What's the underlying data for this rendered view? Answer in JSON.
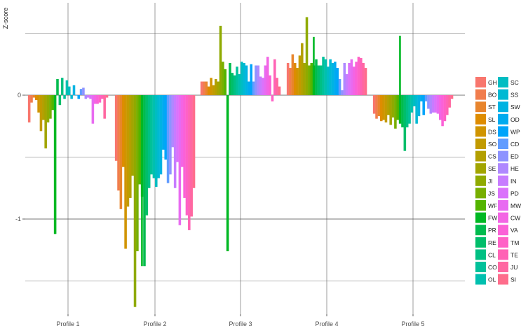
{
  "chart_data": {
    "type": "bar",
    "title": "",
    "xlabel": "",
    "ylabel": "Z-score",
    "categories": [
      "Profile 1",
      "Profile 2",
      "Profile 3",
      "Profile 4",
      "Profile 5"
    ],
    "y_tick_labels": [
      "-1",
      "0"
    ],
    "y_ticks": [
      -1,
      0
    ],
    "ylim": [
      -1.89,
      0.66
    ],
    "grid": true,
    "legend_position": "right",
    "legend_title": "",
    "series_names": [
      "GH",
      "BO",
      "ST",
      "SL",
      "DS",
      "SO",
      "CS",
      "SE",
      "JI",
      "JS",
      "WF",
      "FW",
      "PR",
      "RE",
      "CL",
      "CO",
      "OL",
      "SC",
      "SS",
      "SW",
      "OD",
      "WP",
      "CD",
      "ED",
      "HE",
      "IN",
      "PD",
      "MW",
      "CW",
      "VA",
      "TM",
      "TE",
      "JU",
      "SI"
    ],
    "series_colors": [
      "#F8766D",
      "#F17D4D",
      "#E8852D",
      "#DE8C00",
      "#D09400",
      "#C29A00",
      "#B39F00",
      "#A2A500",
      "#8FAA00",
      "#77AF00",
      "#53B400",
      "#00B823",
      "#00BB4E",
      "#00BE6A",
      "#00C083",
      "#00C19A",
      "#00C0AF",
      "#00BDC2",
      "#00B9D3",
      "#00B3E2",
      "#00ABEF",
      "#00A4FA",
      "#619CFF",
      "#8E93FF",
      "#AF88FF",
      "#C77CFF",
      "#DA72FB",
      "#E86BF1",
      "#F365E4",
      "#FB61D7",
      "#FF61C6",
      "#FF63B5",
      "#FF68A1",
      "#FE6D8C"
    ],
    "values": [
      [
        -0.22,
        -0.06,
        -0.02,
        -0.04,
        -0.14,
        -0.29,
        -0.2,
        -0.43,
        -0.22,
        -0.19,
        -0.12,
        -1.12,
        0.13,
        -0.08,
        0.14,
        -0.03,
        0.12,
        0.07,
        -0.03,
        0.08,
        0.0,
        -0.03,
        0.05,
        0.06,
        -0.03,
        -0.02,
        -0.03,
        -0.23,
        -0.07,
        -0.07,
        -0.06,
        -0.03,
        -0.19,
        -0.02
      ],
      [
        -0.53,
        -0.77,
        -0.92,
        -0.58,
        -1.24,
        -0.9,
        -0.83,
        -0.65,
        -1.71,
        -1.26,
        -0.72,
        -0.82,
        -1.38,
        -0.97,
        -0.75,
        -0.64,
        -0.67,
        -0.74,
        -0.67,
        -0.64,
        -0.44,
        -0.52,
        -0.71,
        -0.64,
        -0.42,
        -0.75,
        -0.54,
        -1.05,
        -0.58,
        -0.83,
        -0.97,
        -1.09,
        -0.98,
        -0.75
      ],
      [
        0.11,
        0.11,
        0.11,
        0.07,
        0.14,
        0.08,
        0.13,
        0.11,
        0.56,
        0.27,
        0.21,
        -1.26,
        0.26,
        0.18,
        0.16,
        0.23,
        0.17,
        0.27,
        0.26,
        0.24,
        0.11,
        0.25,
        0.11,
        0.24,
        0.24,
        0.15,
        0.14,
        0.24,
        0.31,
        0.16,
        -0.05,
        0.29,
        0.14,
        0.07
      ],
      [
        0.26,
        0.22,
        0.33,
        0.26,
        0.22,
        0.32,
        0.42,
        0.26,
        0.63,
        0.24,
        0.26,
        0.24,
        0.29,
        0.24,
        0.24,
        0.31,
        0.29,
        0.23,
        0.29,
        0.26,
        0.27,
        0.22,
        0.13,
        0.04,
        0.26,
        0.17,
        0.26,
        0.29,
        0.23,
        0.27,
        0.31,
        0.3,
        0.26,
        0.22
      ],
      [
        -0.15,
        -0.19,
        -0.17,
        -0.21,
        -0.2,
        -0.22,
        -0.16,
        -0.24,
        -0.18,
        -0.27,
        -0.2,
        -0.23,
        -0.26,
        -0.45,
        -0.26,
        -0.23,
        -0.14,
        -0.09,
        -0.23,
        -0.17,
        -0.05,
        -0.16,
        -0.05,
        -0.11,
        -0.15,
        -0.14,
        -0.14,
        -0.15,
        -0.2,
        -0.25,
        -0.21,
        -0.16,
        -0.1,
        -0.03
      ]
    ],
    "highlight": {
      "series": "FW",
      "values": [
        -1.12,
        -1.38,
        -1.26,
        0.47,
        0.48
      ]
    }
  }
}
